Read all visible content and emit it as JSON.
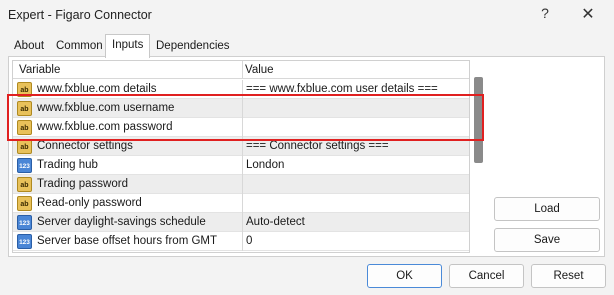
{
  "window": {
    "title": "Expert - Figaro Connector",
    "help_glyph": "?",
    "close_glyph": "✕"
  },
  "tabs": [
    {
      "label": "About"
    },
    {
      "label": "Common"
    },
    {
      "label": "Inputs"
    },
    {
      "label": "Dependencies"
    }
  ],
  "grid": {
    "headers": {
      "variable": "Variable",
      "value": "Value"
    },
    "rows": [
      {
        "icon": "ab",
        "variable": "www.fxblue.com details",
        "value": "=== www.fxblue.com user details ==="
      },
      {
        "icon": "ab",
        "variable": "www.fxblue.com username",
        "value": ""
      },
      {
        "icon": "ab",
        "variable": "www.fxblue.com password",
        "value": ""
      },
      {
        "icon": "ab",
        "variable": "Connector settings",
        "value": "=== Connector settings ==="
      },
      {
        "icon": "123",
        "variable": "Trading hub",
        "value": "London"
      },
      {
        "icon": "ab",
        "variable": "Trading password",
        "value": ""
      },
      {
        "icon": "ab",
        "variable": "Read-only password",
        "value": ""
      },
      {
        "icon": "123",
        "variable": "Server daylight-savings schedule",
        "value": "Auto-detect"
      },
      {
        "icon": "123",
        "variable": "Server base offset hours from GMT",
        "value": "0"
      }
    ]
  },
  "buttons": {
    "load": "Load",
    "save": "Save",
    "ok": "OK",
    "cancel": "Cancel",
    "reset": "Reset"
  },
  "colors": {
    "highlight": "#e02020",
    "ok_border": "#4a8ad8"
  }
}
